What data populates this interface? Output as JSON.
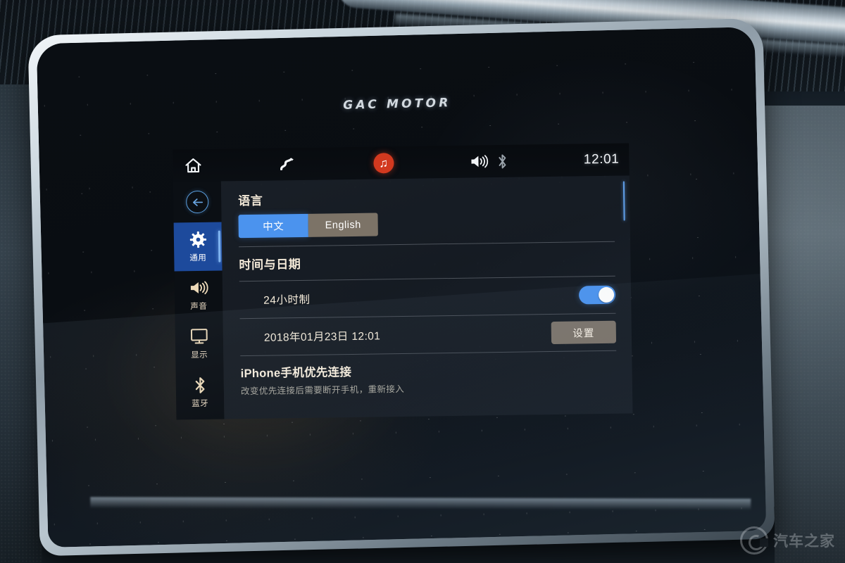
{
  "device": {
    "brand_text": "GAC MOTOR"
  },
  "statusbar": {
    "home_icon": "home-icon",
    "navigation_icon": "navigation-route-icon",
    "music_icon": "music-note-icon",
    "volume_icon": "speaker-volume-icon",
    "bluetooth_icon": "bluetooth-icon",
    "clock": "12:01"
  },
  "sidebar": {
    "back_icon": "back-arrow-icon",
    "items": [
      {
        "label": "通用",
        "icon": "gear-icon",
        "active": true
      },
      {
        "label": "声音",
        "icon": "speaker-volume-icon",
        "active": false
      },
      {
        "label": "显示",
        "icon": "monitor-display-icon",
        "active": false
      },
      {
        "label": "蓝牙",
        "icon": "bluetooth-icon",
        "active": false
      }
    ]
  },
  "content": {
    "language": {
      "heading": "语言",
      "options": [
        {
          "label": "中文",
          "selected": true
        },
        {
          "label": "English",
          "selected": false
        }
      ]
    },
    "datetime": {
      "heading": "时间与日期",
      "clock_format_label": "24小时制",
      "clock_format_on": true,
      "current_datetime": "2018年01月23日  12:01",
      "settings_button": "设置"
    },
    "phone": {
      "title": "iPhone手机优先连接",
      "subtitle": "改变优先连接后需要断开手机，重新接入"
    }
  },
  "watermark": {
    "text": "汽车之家"
  },
  "colors": {
    "accent_blue": "#4b93ee",
    "nav_active_blue": "#1d4a9c",
    "music_red": "#d2391f",
    "grey_button": "#7b746c",
    "text_cream": "#f3ead9"
  }
}
